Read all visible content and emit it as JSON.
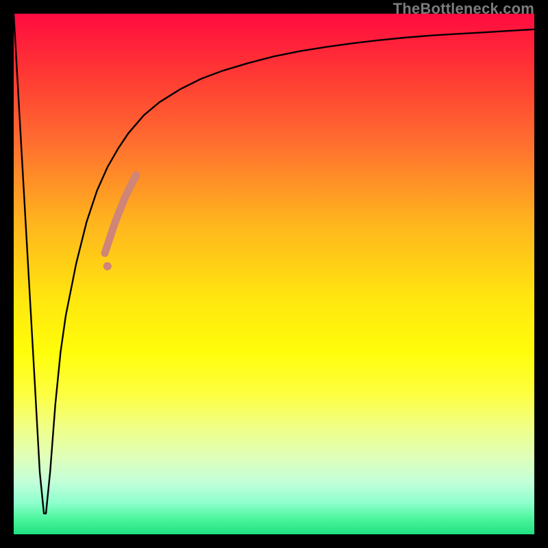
{
  "watermark": "TheBottleneck.com",
  "chart_data": {
    "type": "line",
    "title": "",
    "xlabel": "",
    "ylabel": "",
    "xlim": [
      0,
      100
    ],
    "ylim": [
      0,
      100
    ],
    "grid": false,
    "legend": false,
    "series": [
      {
        "name": "bottleneck-curve",
        "x": [
          0,
          2,
          4,
          5,
          5.8,
          6.2,
          7,
          8,
          9,
          10,
          12,
          14,
          16,
          18,
          20,
          22,
          25,
          28,
          32,
          36,
          40,
          45,
          50,
          55,
          60,
          65,
          70,
          75,
          80,
          85,
          90,
          95,
          100
        ],
        "values": [
          100,
          65,
          30,
          12,
          4,
          4,
          12,
          25,
          35,
          42,
          52,
          60,
          66,
          70.5,
          74,
          77,
          80.5,
          83,
          85.5,
          87.5,
          89,
          90.5,
          91.8,
          92.8,
          93.6,
          94.3,
          94.9,
          95.4,
          95.8,
          96.1,
          96.4,
          96.7,
          97
        ]
      }
    ],
    "highlight_segment": {
      "name": "highlight-band",
      "x": [
        17.5,
        18.5,
        19.5,
        20.5,
        21.5,
        22.5,
        23.5
      ],
      "values": [
        54,
        57,
        60,
        62.5,
        65,
        67,
        69
      ]
    },
    "highlight_dot": {
      "name": "highlight-dot",
      "x": 18,
      "value": 51.5
    },
    "gradient_stops": [
      {
        "pos": 0,
        "color": "#ff0b40"
      },
      {
        "pos": 10,
        "color": "#ff3235"
      },
      {
        "pos": 25,
        "color": "#ff6f2f"
      },
      {
        "pos": 40,
        "color": "#ffb41e"
      },
      {
        "pos": 55,
        "color": "#ffe70f"
      },
      {
        "pos": 65,
        "color": "#fffd0a"
      },
      {
        "pos": 73,
        "color": "#fdff40"
      },
      {
        "pos": 79,
        "color": "#f1ff82"
      },
      {
        "pos": 85,
        "color": "#e0ffb8"
      },
      {
        "pos": 90,
        "color": "#c2ffd9"
      },
      {
        "pos": 94,
        "color": "#8dffcd"
      },
      {
        "pos": 97,
        "color": "#4cf59c"
      },
      {
        "pos": 100,
        "color": "#1fe181"
      }
    ],
    "colors": {
      "curve": "#000000",
      "highlight": "#cf8577",
      "frame": "#000000"
    }
  }
}
